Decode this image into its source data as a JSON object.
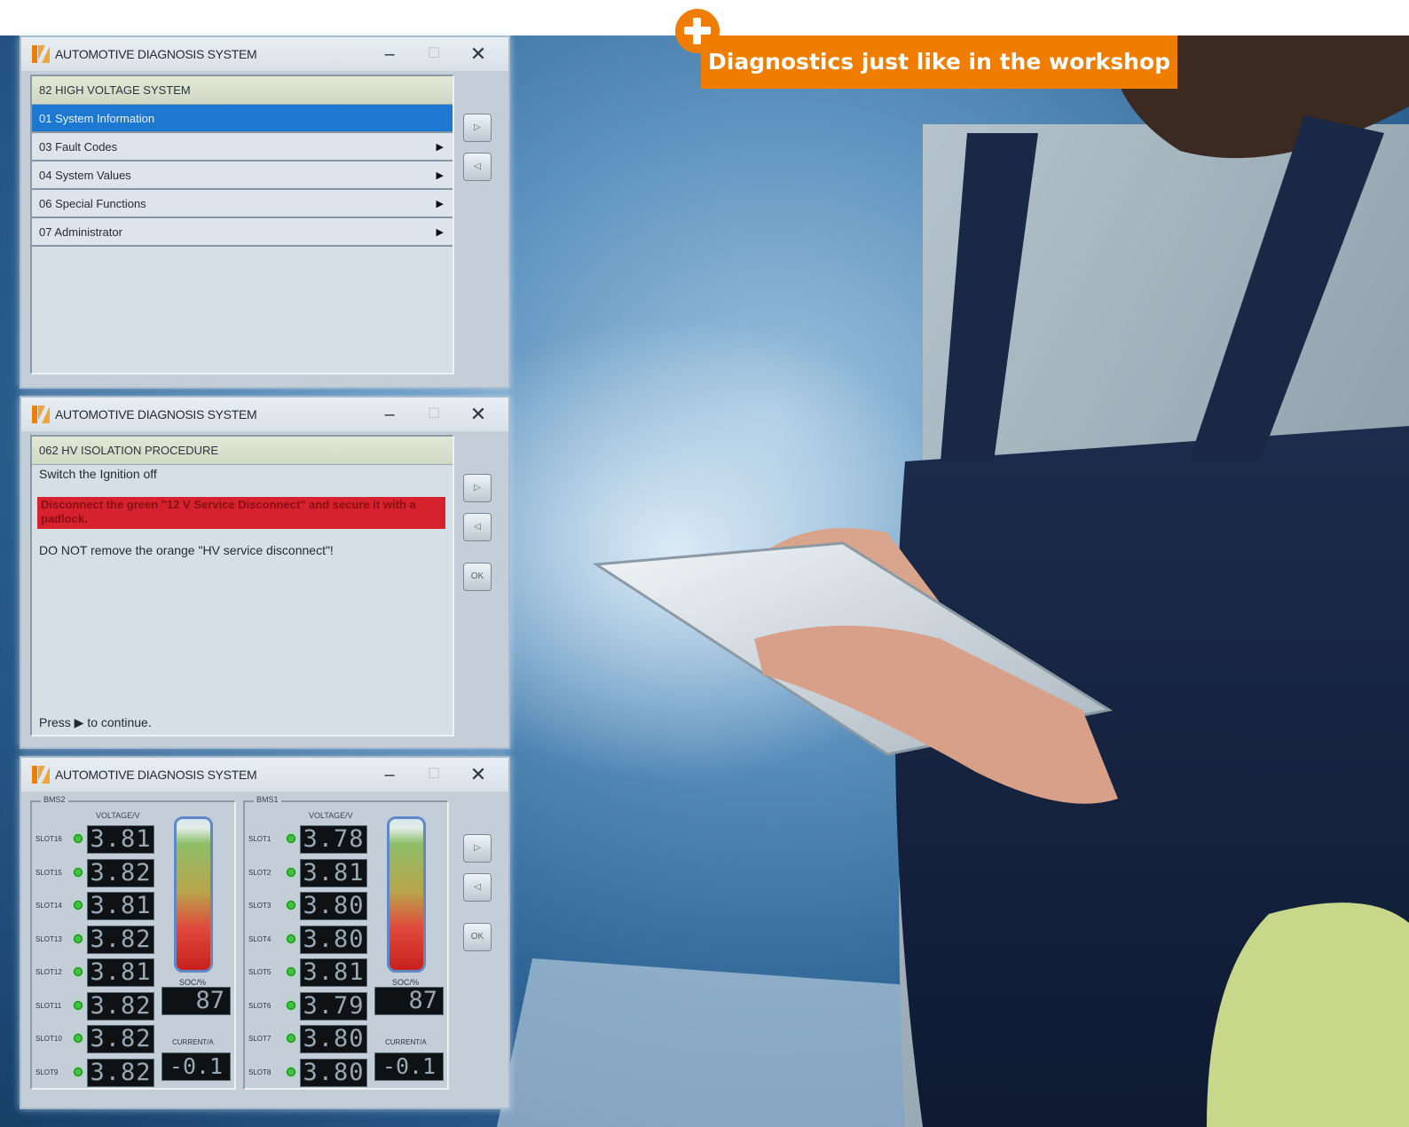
{
  "promo": {
    "text": "Diagnostics just like in the workshop"
  },
  "windows": [
    {
      "title": "AUTOMOTIVE DIAGNOSIS SYSTEM",
      "menu_header": "82 HIGH VOLTAGE SYSTEM",
      "items": [
        {
          "label": "01 System Information"
        },
        {
          "label": "03 Fault Codes"
        },
        {
          "label": "04 System Values"
        },
        {
          "label": "06 Special Functions"
        },
        {
          "label": "07 Administrator"
        }
      ]
    },
    {
      "title": "AUTOMOTIVE DIAGNOSIS SYSTEM",
      "header": "062 HV ISOLATION PROCEDURE",
      "line1": "Switch the Ignition off",
      "warning": "Disconnect the green \"12 V Service Disconnect\" and secure it with a padlock.",
      "line3": "DO NOT remove the orange \"HV service disconnect\"!",
      "footer": "Press ▶ to continue.",
      "ok_label": "OK"
    },
    {
      "title": "AUTOMOTIVE DIAGNOSIS SYSTEM",
      "ok_label": "OK",
      "voltage_label": "VOLTAGE/V",
      "soc_label": "SOC/%",
      "current_label": "CURRENT/A",
      "bms": [
        {
          "name": "BMS2",
          "slots": [
            {
              "label": "SLOT16",
              "value": "3.81"
            },
            {
              "label": "SLOT15",
              "value": "3.82"
            },
            {
              "label": "SLOT14",
              "value": "3.81"
            },
            {
              "label": "SLOT13",
              "value": "3.82"
            },
            {
              "label": "SLOT12",
              "value": "3.81"
            },
            {
              "label": "SLOT11",
              "value": "3.82"
            },
            {
              "label": "SLOT10",
              "value": "3.82"
            },
            {
              "label": "SLOT9",
              "value": "3.82"
            }
          ],
          "soc": "87",
          "current": "-0.1"
        },
        {
          "name": "BMS1",
          "slots": [
            {
              "label": "SLOT1",
              "value": "3.78"
            },
            {
              "label": "SLOT2",
              "value": "3.81"
            },
            {
              "label": "SLOT3",
              "value": "3.80"
            },
            {
              "label": "SLOT4",
              "value": "3.80"
            },
            {
              "label": "SLOT5",
              "value": "3.81"
            },
            {
              "label": "SLOT6",
              "value": "3.79"
            },
            {
              "label": "SLOT7",
              "value": "3.80"
            },
            {
              "label": "SLOT8",
              "value": "3.80"
            }
          ],
          "soc": "87",
          "current": "-0.1"
        }
      ]
    }
  ]
}
